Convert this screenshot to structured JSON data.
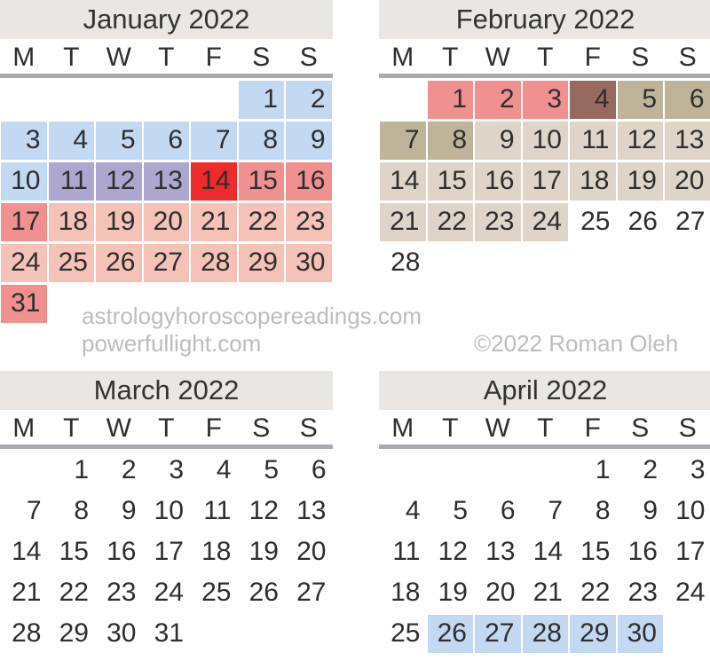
{
  "colors": {
    "title_bg": "#e9e6e4",
    "rule": "#a9abb0",
    "text": "#2e2e2e",
    "watermark": "#bdbdbd",
    "blue": "#c3d9f2",
    "purple": "#ada6cf",
    "red": "#ee2b2b",
    "salmon": "#f09090",
    "pink": "#f5c2b8",
    "brown": "#97695f",
    "dark_tan": "#bfb49a",
    "light_tan": "#ded4c7",
    "none": "transparent"
  },
  "weekday_headers": [
    "M",
    "T",
    "W",
    "T",
    "F",
    "S",
    "S"
  ],
  "watermark": {
    "site1": "astrologyhoroscopereadings.com",
    "site2": "powerfullight.com",
    "copyright": "©2022 Roman Oleh"
  },
  "months": [
    {
      "id": "january",
      "title": "January 2022",
      "weeks": [
        [
          {
            "d": "",
            "c": "none"
          },
          {
            "d": "",
            "c": "none"
          },
          {
            "d": "",
            "c": "none"
          },
          {
            "d": "",
            "c": "none"
          },
          {
            "d": "",
            "c": "none"
          },
          {
            "d": "1",
            "c": "blue"
          },
          {
            "d": "2",
            "c": "blue"
          }
        ],
        [
          {
            "d": "3",
            "c": "blue"
          },
          {
            "d": "4",
            "c": "blue"
          },
          {
            "d": "5",
            "c": "blue"
          },
          {
            "d": "6",
            "c": "blue"
          },
          {
            "d": "7",
            "c": "blue"
          },
          {
            "d": "8",
            "c": "blue"
          },
          {
            "d": "9",
            "c": "blue"
          }
        ],
        [
          {
            "d": "10",
            "c": "blue"
          },
          {
            "d": "11",
            "c": "purple"
          },
          {
            "d": "12",
            "c": "purple"
          },
          {
            "d": "13",
            "c": "purple"
          },
          {
            "d": "14",
            "c": "red"
          },
          {
            "d": "15",
            "c": "salmon"
          },
          {
            "d": "16",
            "c": "salmon"
          }
        ],
        [
          {
            "d": "17",
            "c": "salmon"
          },
          {
            "d": "18",
            "c": "pink"
          },
          {
            "d": "19",
            "c": "pink"
          },
          {
            "d": "20",
            "c": "pink"
          },
          {
            "d": "21",
            "c": "pink"
          },
          {
            "d": "22",
            "c": "pink"
          },
          {
            "d": "23",
            "c": "pink"
          }
        ],
        [
          {
            "d": "24",
            "c": "pink"
          },
          {
            "d": "25",
            "c": "pink"
          },
          {
            "d": "26",
            "c": "pink"
          },
          {
            "d": "27",
            "c": "pink"
          },
          {
            "d": "28",
            "c": "pink"
          },
          {
            "d": "29",
            "c": "pink"
          },
          {
            "d": "30",
            "c": "pink"
          }
        ],
        [
          {
            "d": "31",
            "c": "salmon"
          },
          {
            "d": "",
            "c": "none"
          },
          {
            "d": "",
            "c": "none"
          },
          {
            "d": "",
            "c": "none"
          },
          {
            "d": "",
            "c": "none"
          },
          {
            "d": "",
            "c": "none"
          },
          {
            "d": "",
            "c": "none"
          }
        ]
      ]
    },
    {
      "id": "february",
      "title": "February 2022",
      "weeks": [
        [
          {
            "d": "",
            "c": "none"
          },
          {
            "d": "1",
            "c": "salmon"
          },
          {
            "d": "2",
            "c": "salmon"
          },
          {
            "d": "3",
            "c": "salmon"
          },
          {
            "d": "4",
            "c": "brown"
          },
          {
            "d": "5",
            "c": "dark_tan"
          },
          {
            "d": "6",
            "c": "dark_tan"
          }
        ],
        [
          {
            "d": "7",
            "c": "dark_tan"
          },
          {
            "d": "8",
            "c": "dark_tan"
          },
          {
            "d": "9",
            "c": "light_tan"
          },
          {
            "d": "10",
            "c": "light_tan"
          },
          {
            "d": "11",
            "c": "light_tan"
          },
          {
            "d": "12",
            "c": "light_tan"
          },
          {
            "d": "13",
            "c": "light_tan"
          }
        ],
        [
          {
            "d": "14",
            "c": "light_tan"
          },
          {
            "d": "15",
            "c": "light_tan"
          },
          {
            "d": "16",
            "c": "light_tan"
          },
          {
            "d": "17",
            "c": "light_tan"
          },
          {
            "d": "18",
            "c": "light_tan"
          },
          {
            "d": "19",
            "c": "light_tan"
          },
          {
            "d": "20",
            "c": "light_tan"
          }
        ],
        [
          {
            "d": "21",
            "c": "light_tan"
          },
          {
            "d": "22",
            "c": "light_tan"
          },
          {
            "d": "23",
            "c": "light_tan"
          },
          {
            "d": "24",
            "c": "light_tan"
          },
          {
            "d": "25",
            "c": "none"
          },
          {
            "d": "26",
            "c": "none"
          },
          {
            "d": "27",
            "c": "none"
          }
        ],
        [
          {
            "d": "28",
            "c": "none"
          },
          {
            "d": "",
            "c": "none"
          },
          {
            "d": "",
            "c": "none"
          },
          {
            "d": "",
            "c": "none"
          },
          {
            "d": "",
            "c": "none"
          },
          {
            "d": "",
            "c": "none"
          },
          {
            "d": "",
            "c": "none"
          }
        ]
      ]
    },
    {
      "id": "march",
      "title": "March 2022",
      "weeks": [
        [
          {
            "d": "",
            "c": "none"
          },
          {
            "d": "1",
            "c": "none"
          },
          {
            "d": "2",
            "c": "none"
          },
          {
            "d": "3",
            "c": "none"
          },
          {
            "d": "4",
            "c": "none"
          },
          {
            "d": "5",
            "c": "none"
          },
          {
            "d": "6",
            "c": "none"
          }
        ],
        [
          {
            "d": "7",
            "c": "none"
          },
          {
            "d": "8",
            "c": "none"
          },
          {
            "d": "9",
            "c": "none"
          },
          {
            "d": "10",
            "c": "none"
          },
          {
            "d": "11",
            "c": "none"
          },
          {
            "d": "12",
            "c": "none"
          },
          {
            "d": "13",
            "c": "none"
          }
        ],
        [
          {
            "d": "14",
            "c": "none"
          },
          {
            "d": "15",
            "c": "none"
          },
          {
            "d": "16",
            "c": "none"
          },
          {
            "d": "17",
            "c": "none"
          },
          {
            "d": "18",
            "c": "none"
          },
          {
            "d": "19",
            "c": "none"
          },
          {
            "d": "20",
            "c": "none"
          }
        ],
        [
          {
            "d": "21",
            "c": "none"
          },
          {
            "d": "22",
            "c": "none"
          },
          {
            "d": "23",
            "c": "none"
          },
          {
            "d": "24",
            "c": "none"
          },
          {
            "d": "25",
            "c": "none"
          },
          {
            "d": "26",
            "c": "none"
          },
          {
            "d": "27",
            "c": "none"
          }
        ],
        [
          {
            "d": "28",
            "c": "none"
          },
          {
            "d": "29",
            "c": "none"
          },
          {
            "d": "30",
            "c": "none"
          },
          {
            "d": "31",
            "c": "none"
          },
          {
            "d": "",
            "c": "none"
          },
          {
            "d": "",
            "c": "none"
          },
          {
            "d": "",
            "c": "none"
          }
        ]
      ]
    },
    {
      "id": "april",
      "title": "April 2022",
      "weeks": [
        [
          {
            "d": "",
            "c": "none"
          },
          {
            "d": "",
            "c": "none"
          },
          {
            "d": "",
            "c": "none"
          },
          {
            "d": "",
            "c": "none"
          },
          {
            "d": "1",
            "c": "none"
          },
          {
            "d": "2",
            "c": "none"
          },
          {
            "d": "3",
            "c": "none"
          }
        ],
        [
          {
            "d": "4",
            "c": "none"
          },
          {
            "d": "5",
            "c": "none"
          },
          {
            "d": "6",
            "c": "none"
          },
          {
            "d": "7",
            "c": "none"
          },
          {
            "d": "8",
            "c": "none"
          },
          {
            "d": "9",
            "c": "none"
          },
          {
            "d": "10",
            "c": "none"
          }
        ],
        [
          {
            "d": "11",
            "c": "none"
          },
          {
            "d": "12",
            "c": "none"
          },
          {
            "d": "13",
            "c": "none"
          },
          {
            "d": "14",
            "c": "none"
          },
          {
            "d": "15",
            "c": "none"
          },
          {
            "d": "16",
            "c": "none"
          },
          {
            "d": "17",
            "c": "none"
          }
        ],
        [
          {
            "d": "18",
            "c": "none"
          },
          {
            "d": "19",
            "c": "none"
          },
          {
            "d": "20",
            "c": "none"
          },
          {
            "d": "21",
            "c": "none"
          },
          {
            "d": "22",
            "c": "none"
          },
          {
            "d": "23",
            "c": "none"
          },
          {
            "d": "24",
            "c": "none"
          }
        ],
        [
          {
            "d": "25",
            "c": "none"
          },
          {
            "d": "26",
            "c": "blue"
          },
          {
            "d": "27",
            "c": "blue"
          },
          {
            "d": "28",
            "c": "blue"
          },
          {
            "d": "29",
            "c": "blue"
          },
          {
            "d": "30",
            "c": "blue"
          },
          {
            "d": "",
            "c": "none"
          }
        ]
      ]
    }
  ]
}
